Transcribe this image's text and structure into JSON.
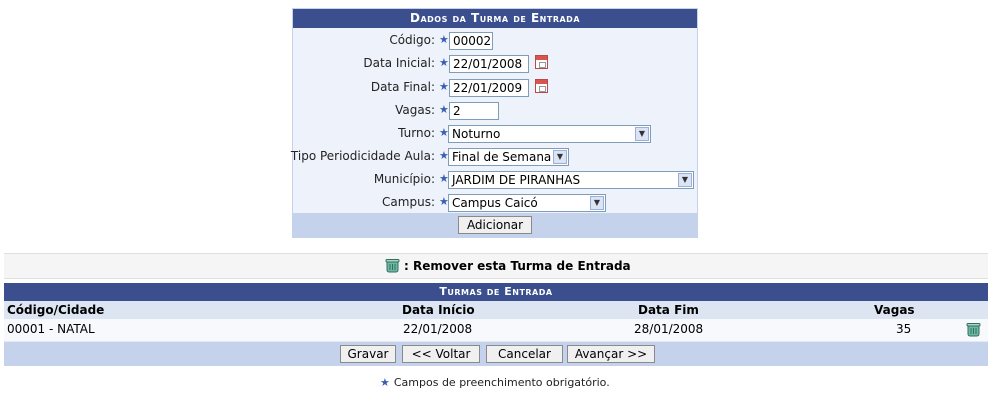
{
  "form": {
    "title": "Dados da Turma de Entrada",
    "fields": [
      {
        "label": "Código:",
        "value": "00002"
      },
      {
        "label": "Data Inicial:",
        "value": "22/01/2008"
      },
      {
        "label": "Data Final:",
        "value": "22/01/2009"
      },
      {
        "label": "Vagas:",
        "value": "2"
      },
      {
        "label": "Turno:",
        "value": "Noturno"
      },
      {
        "label": "Tipo Periodicidade Aula:",
        "value": "Final de Semana"
      },
      {
        "label": "Município:",
        "value": "JARDIM DE PIRANHAS"
      },
      {
        "label": "Campus:",
        "value": "Campus Caicó"
      }
    ],
    "required_icon": "blue-star-icon",
    "add_button": "Adicionar"
  },
  "legend": {
    "icon": "trash-icon",
    "text": ": Remover esta Turma de Entrada"
  },
  "list": {
    "title": "Turmas de Entrada",
    "columns": [
      "Código/Cidade",
      "Data Início",
      "Data Fim",
      "Vagas"
    ],
    "rows": [
      {
        "codigo_cidade": "00001 - NATAL",
        "data_inicio": "22/01/2008",
        "data_fim": "28/01/2008",
        "vagas": "35"
      }
    ],
    "buttons": {
      "gravar": "Gravar",
      "voltar": "<< Voltar",
      "cancelar": "Cancelar",
      "avancar": "Avançar >>"
    }
  },
  "note": "Campos de preenchimento obrigatório.",
  "colors": {
    "header_bg": "#3b4f8e",
    "panel_bg": "#eef3fb",
    "footer_bg": "#c4d2eb"
  }
}
